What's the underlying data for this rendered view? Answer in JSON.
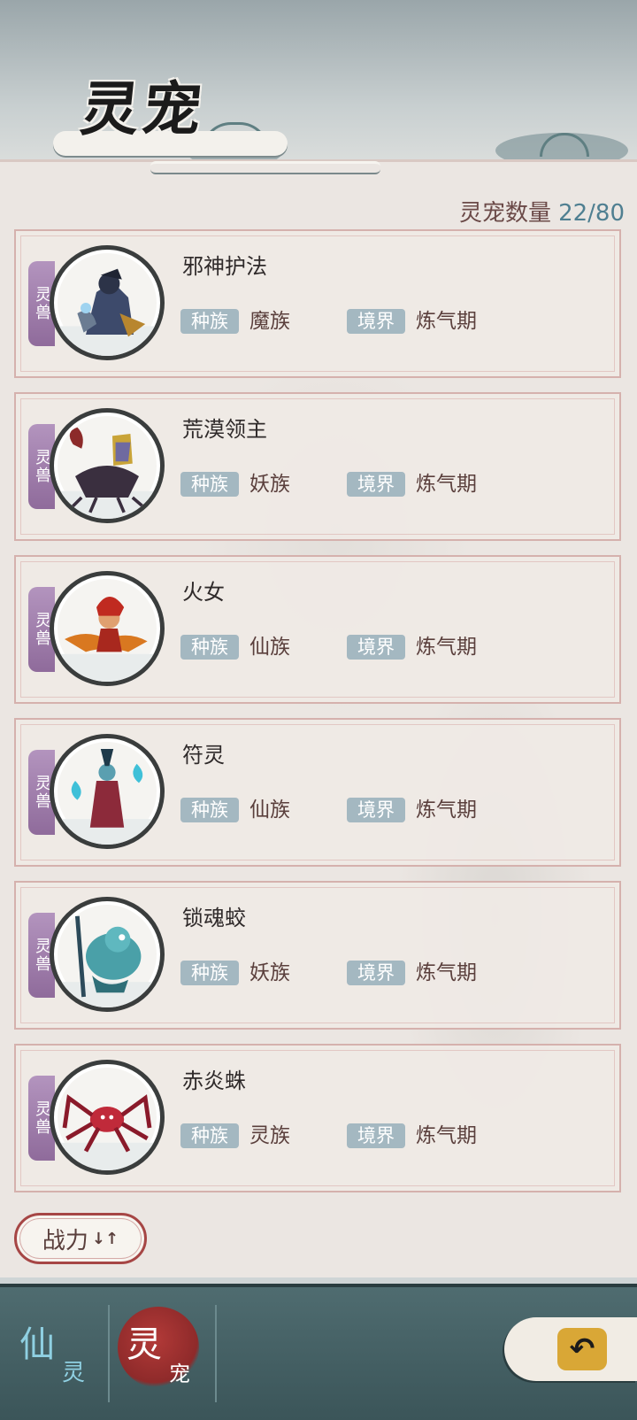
{
  "header": {
    "title": "灵宠"
  },
  "count": {
    "label": "灵宠数量",
    "value": "22/80"
  },
  "labels": {
    "race": "种族",
    "realm": "境界",
    "beast_tag": "灵兽"
  },
  "pets": [
    {
      "name": "邪神护法",
      "race": "魔族",
      "realm": "炼气期",
      "tag": "灵兽"
    },
    {
      "name": "荒漠领主",
      "race": "妖族",
      "realm": "炼气期",
      "tag": "灵兽"
    },
    {
      "name": "火女",
      "race": "仙族",
      "realm": "炼气期",
      "tag": "灵兽"
    },
    {
      "name": "符灵",
      "race": "仙族",
      "realm": "炼气期",
      "tag": "灵兽"
    },
    {
      "name": "锁魂蛟",
      "race": "妖族",
      "realm": "炼气期",
      "tag": "灵兽"
    },
    {
      "name": "赤炎蛛",
      "race": "灵族",
      "realm": "炼气期",
      "tag": "灵兽"
    }
  ],
  "sort": {
    "label": "战力",
    "arrows": "↓↑"
  },
  "bottom_tabs": [
    {
      "big": "仙",
      "small": "灵"
    },
    {
      "big": "灵",
      "small": "宠"
    }
  ],
  "icons": {
    "back": "back-arrow-icon"
  },
  "colors": {
    "accent": "#a64645",
    "chip": "#a4b8c1",
    "tag": "#8f6b9b",
    "count_value": "#4f7f91"
  }
}
